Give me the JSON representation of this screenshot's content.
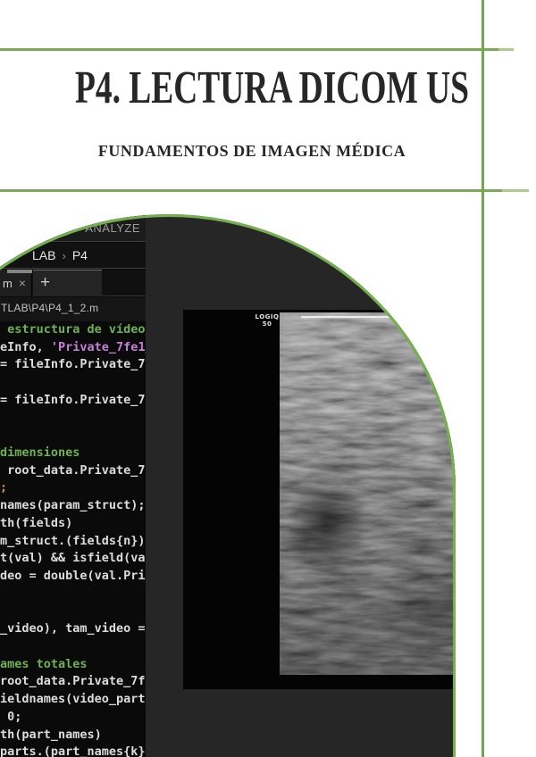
{
  "document": {
    "title": "P4. LECTURA DICOM US",
    "subtitle": "FUNDAMENTOS DE IMAGEN MÉDICA"
  },
  "accent_colors": {
    "rule_green": "#79a959",
    "vertical_rule_green": "#6fa94e",
    "arch_border_green": "#74b14e"
  },
  "matlab_screenshot": {
    "ribbon_tab": "ANALYZE",
    "breadcrumb": {
      "parent": "LAB",
      "separator": "›",
      "current": "P4"
    },
    "editor_tab": {
      "label_fragment": "m",
      "close_icon": "×",
      "new_tab_icon": "+"
    },
    "file_path": "TLAB\\P4\\P4_1_2.m",
    "syntax_colors": {
      "comment": "#6fb153",
      "string": "#c77fd9",
      "default": "#dcdcdc",
      "system": "#ce8d5e"
    },
    "code_lines": [
      {
        "segments": [
          {
            "text": " estructura de vídeo",
            "type": "comment"
          }
        ]
      },
      {
        "segments": [
          {
            "text": "eInfo, ",
            "type": "code"
          },
          {
            "text": "'Private_7fe1_",
            "type": "string"
          }
        ]
      },
      {
        "segments": [
          {
            "text": "= fileInfo.Private_7",
            "type": "code"
          }
        ]
      },
      {
        "segments": []
      },
      {
        "segments": [
          {
            "text": "= fileInfo.Private_7",
            "type": "code"
          }
        ]
      },
      {
        "segments": []
      },
      {
        "segments": []
      },
      {
        "segments": [
          {
            "text": "dimensiones",
            "type": "comment"
          }
        ]
      },
      {
        "segments": [
          {
            "text": " root_data.Private_7",
            "type": "code"
          }
        ]
      },
      {
        "segments": [
          {
            "text": ";",
            "type": "system"
          }
        ]
      },
      {
        "segments": [
          {
            "text": "names(param_struct);",
            "type": "code"
          }
        ]
      },
      {
        "segments": [
          {
            "text": "th(fields)",
            "type": "code"
          }
        ]
      },
      {
        "segments": [
          {
            "text": "m_struct.(fields{n})",
            "type": "code"
          }
        ]
      },
      {
        "segments": [
          {
            "text": "t(val) && isfield(va",
            "type": "code"
          }
        ]
      },
      {
        "segments": [
          {
            "text": "deo = double(val.Pri",
            "type": "code"
          }
        ]
      },
      {
        "segments": []
      },
      {
        "segments": []
      },
      {
        "segments": [
          {
            "text": "_video), tam_video =",
            "type": "code"
          }
        ]
      },
      {
        "segments": []
      },
      {
        "segments": [
          {
            "text": "ames totales",
            "type": "comment"
          }
        ]
      },
      {
        "segments": [
          {
            "text": "root_data.Private_7f",
            "type": "code"
          }
        ]
      },
      {
        "segments": [
          {
            "text": "ieldnames(video_part",
            "type": "code"
          }
        ]
      },
      {
        "segments": [
          {
            "text": " 0;",
            "type": "code"
          }
        ]
      },
      {
        "segments": [
          {
            "text": "th(part_names)",
            "type": "code"
          }
        ]
      },
      {
        "segments": [
          {
            "text": "parts.(part_names{k}",
            "type": "code"
          }
        ]
      }
    ]
  },
  "ultrasound": {
    "device_label_line1": "LOGIQ",
    "device_label_line2": "50"
  }
}
